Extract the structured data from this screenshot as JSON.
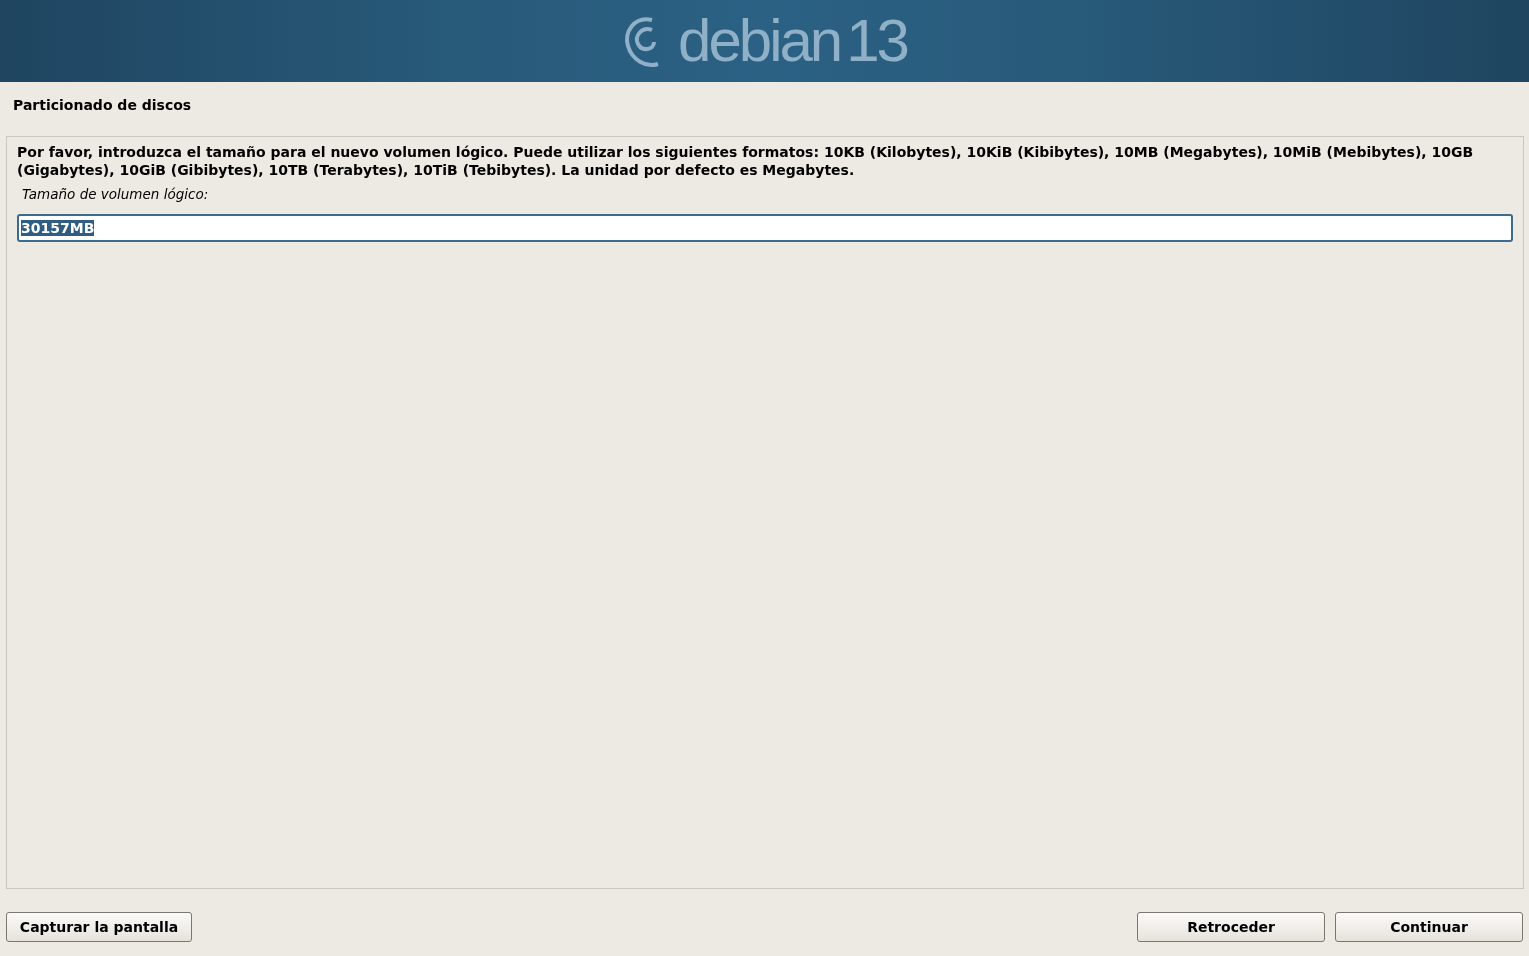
{
  "banner": {
    "logo_text": "debian",
    "version": "13"
  },
  "title": "Particionado de discos",
  "message": "Por favor, introduzca el tamaño para el nuevo volumen lógico. Puede utilizar los siguientes formatos: 10KB (Kilobytes), 10KiB (Kibibytes), 10MB (Megabytes), 10MiB (Mebibytes), 10GB (Gigabytes), 10GiB (Gibibytes), 10TB (Terabytes), 10TiB (Tebibytes). La unidad por defecto es Megabytes.",
  "field": {
    "label": "Tamaño de volumen lógico:",
    "value": "30157MB",
    "selected": true
  },
  "buttons_left": [
    "Capturar la pantalla"
  ],
  "buttons_right": [
    "Retroceder",
    "Continuar"
  ]
}
